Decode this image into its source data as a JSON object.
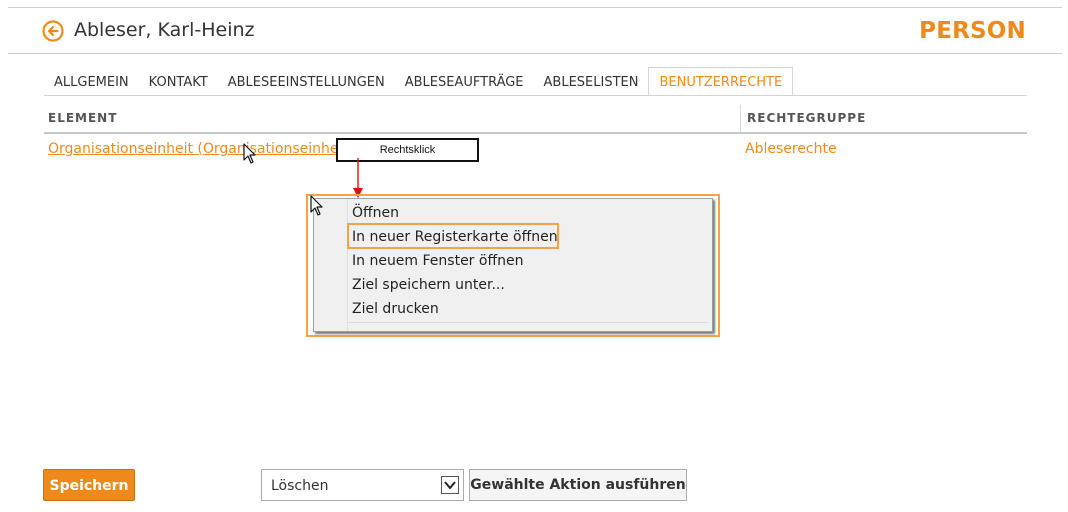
{
  "header": {
    "person_name": "Ableser, Karl-Heinz",
    "brand": "PERSON"
  },
  "tabs": [
    {
      "label": "ALLGEMEIN"
    },
    {
      "label": "KONTAKT"
    },
    {
      "label": "ABLESEEINSTELLUNGEN"
    },
    {
      "label": "ABLESEAUFTRÄGE"
    },
    {
      "label": "ABLESELISTEN"
    },
    {
      "label": "BENUTZERRECHTE",
      "active": true
    }
  ],
  "table": {
    "columns": [
      "ELEMENT",
      "RECHTEGRUPPE"
    ],
    "rows": [
      {
        "element": "Organisationseinheit (Organisationseinheit)",
        "group": "Ableserechte"
      }
    ]
  },
  "annotation": {
    "callout": "Rechtsklick"
  },
  "context_menu": {
    "items": [
      "Öffnen",
      "In neuer Registerkarte öffnen",
      "In neuem Fenster öffnen",
      "Ziel speichern unter...",
      "Ziel drucken"
    ]
  },
  "footer": {
    "save_label": "Speichern",
    "action_select_value": "Löschen",
    "execute_label": "Gewählte Aktion ausführen"
  },
  "colors": {
    "accent": "#ef8a1a"
  },
  "icons": {
    "back": "arrow-left-circle-icon",
    "cursor": "mouse-pointer-icon",
    "dropdown": "chevron-down-icon"
  }
}
